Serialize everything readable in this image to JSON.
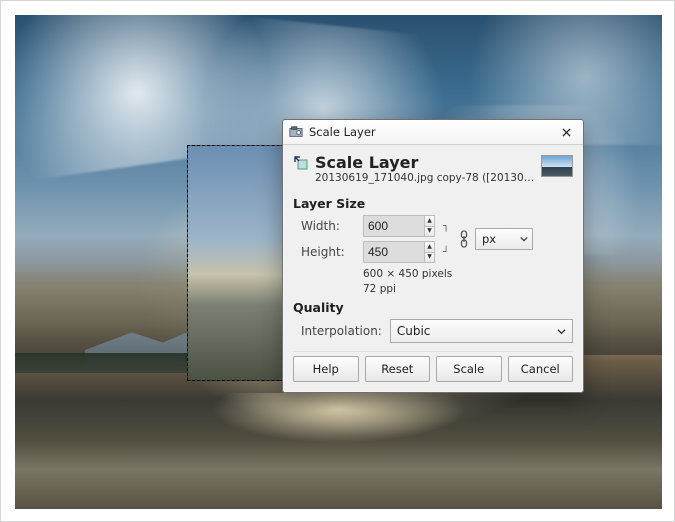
{
  "window": {
    "title": "Scale Layer"
  },
  "header": {
    "title": "Scale Layer",
    "subtitle": "20130619_171040.jpg copy-78 ([20130701_..."
  },
  "layer_size": {
    "section_label": "Layer Size",
    "width_label": "Width:",
    "height_label": "Height:",
    "width_value": "600",
    "height_value": "450",
    "unit": "px",
    "info_dims": "600 × 450 pixels",
    "info_ppi": "72 ppi"
  },
  "quality": {
    "section_label": "Quality",
    "interpolation_label": "Interpolation:",
    "interpolation_value": "Cubic"
  },
  "buttons": {
    "help": "Help",
    "reset": "Reset",
    "scale": "Scale",
    "cancel": "Cancel"
  }
}
